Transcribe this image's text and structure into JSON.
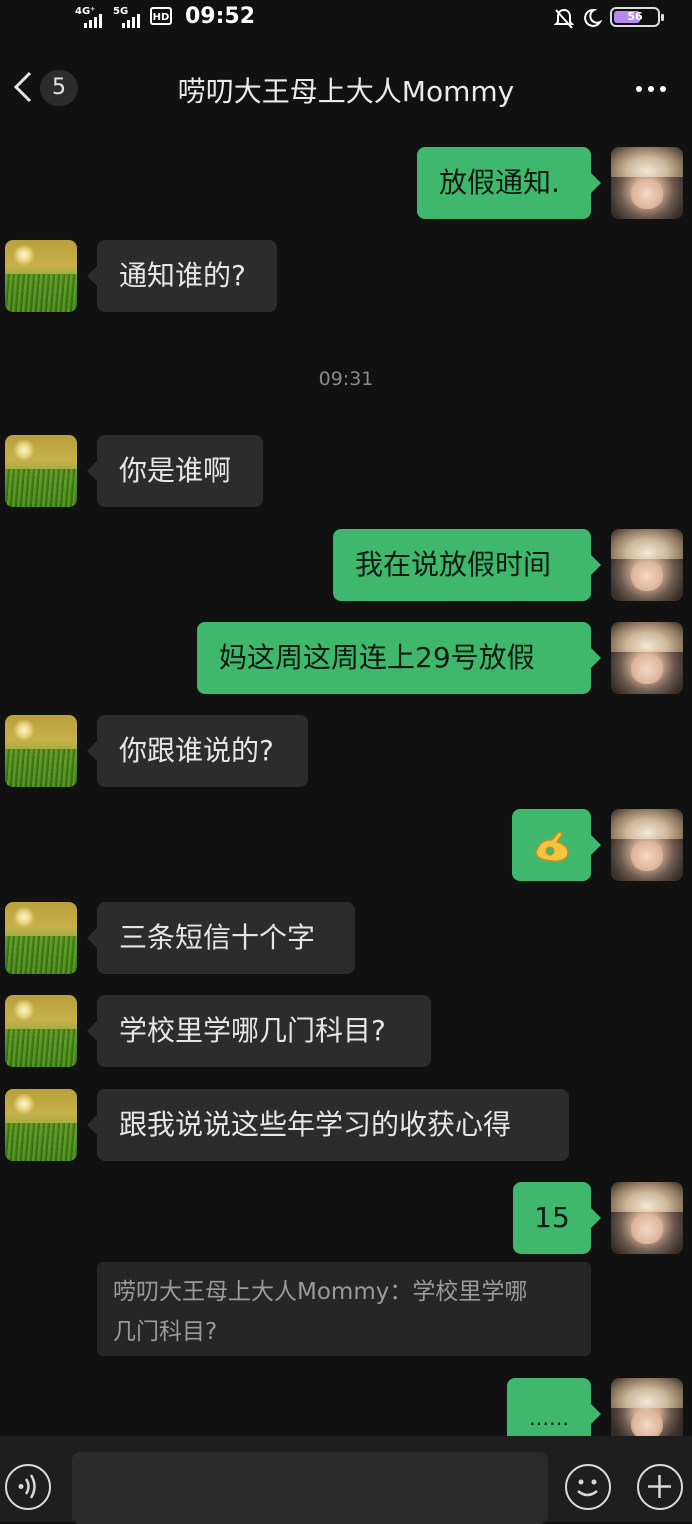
{
  "status_bar": {
    "net1": "4G⁺",
    "net2": "5G",
    "hd": "HD",
    "time": "09:52",
    "battery": "56"
  },
  "header": {
    "unread_count": "5",
    "title": "唠叨大王母上大人Mommy"
  },
  "messages": [
    {
      "side": "right",
      "text": "放假通知."
    },
    {
      "side": "left",
      "text": "通知谁的?"
    },
    {
      "side": "left",
      "text": "你是谁啊"
    },
    {
      "side": "right",
      "text": "我在说放假时间"
    },
    {
      "side": "right",
      "text": "妈这周这周连上29号放假"
    },
    {
      "side": "left",
      "text": "你跟谁说的?"
    },
    {
      "side": "right",
      "text": "",
      "emoji": "ok-hand-icon"
    },
    {
      "side": "left",
      "text": "三条短信十个字"
    },
    {
      "side": "left",
      "text": "学校里学哪几门科目?"
    },
    {
      "side": "left",
      "text": "跟我说说这些年学习的收获心得"
    },
    {
      "side": "right",
      "text": "15"
    },
    {
      "side": "right",
      "text": "……"
    }
  ],
  "timestamp": "09:31",
  "quote": {
    "line1": "唠叨大王母上大人Mommy：学校里学哪",
    "line2": "几门科目?"
  },
  "input": {
    "placeholder": ""
  },
  "colors": {
    "sent_bubble": "#3fb86e",
    "received_bubble": "#2c2c2c",
    "background": "#111111"
  }
}
